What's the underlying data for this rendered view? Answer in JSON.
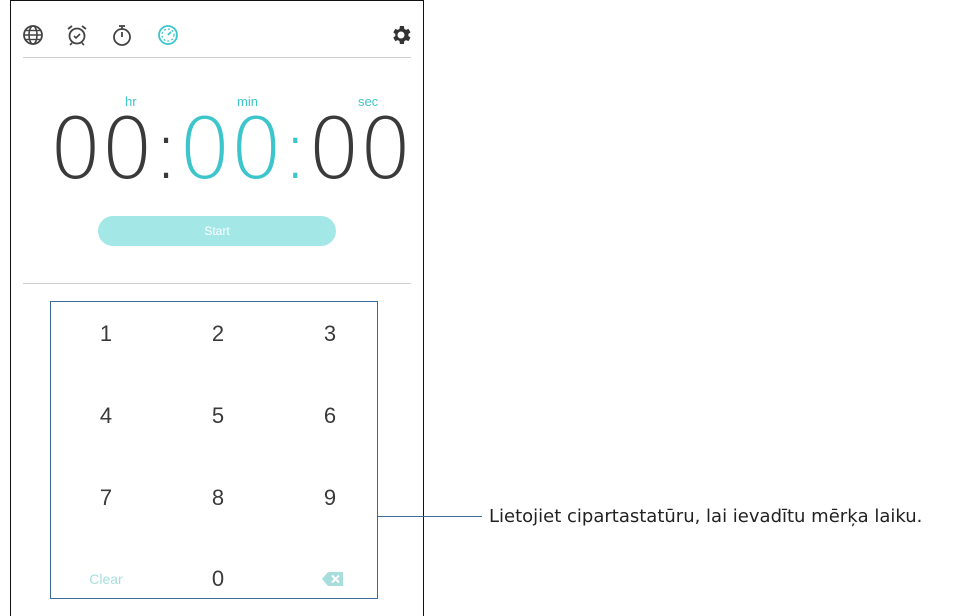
{
  "tabs": [
    {
      "name": "world-clock",
      "icon": "globe-icon"
    },
    {
      "name": "alarm",
      "icon": "alarm-clock-icon"
    },
    {
      "name": "stopwatch",
      "icon": "stopwatch-icon"
    },
    {
      "name": "timer",
      "icon": "timer-icon",
      "active": true
    }
  ],
  "settings_icon": "gear-icon",
  "timer": {
    "units": {
      "hr": "hr",
      "min": "min",
      "sec": "sec"
    },
    "hours": "00",
    "minutes": "00",
    "seconds": "00",
    "separator": ":"
  },
  "start_label": "Start",
  "keypad": {
    "keys": [
      "1",
      "2",
      "3",
      "4",
      "5",
      "6",
      "7",
      "8",
      "9"
    ],
    "clear_label": "Clear",
    "zero": "0",
    "backspace_icon": "backspace-icon"
  },
  "callout": "Lietojiet cipartastatūru, lai ievadītu mērķa laiku.",
  "colors": {
    "accent": "#3dc5cc",
    "start_button": "#a3e8e6",
    "digits": "#3a3a3a",
    "callout_line": "#3a6a9a"
  }
}
